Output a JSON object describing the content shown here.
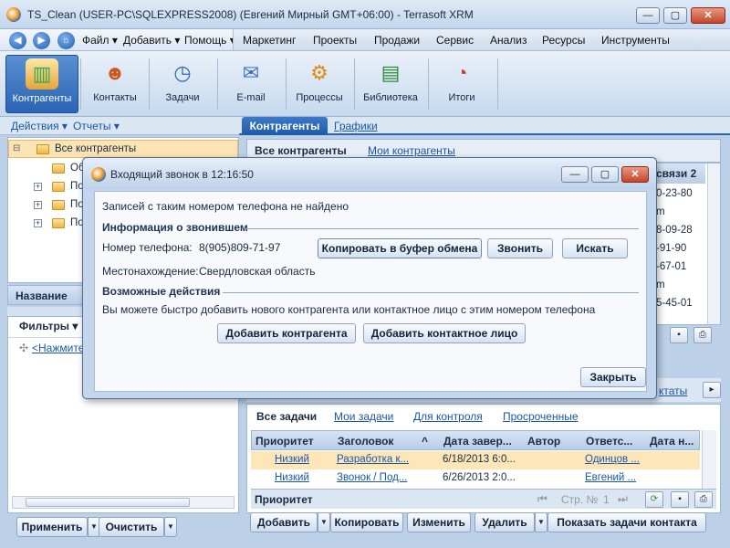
{
  "window": {
    "title": "TS_Clean (USER-PC\\SQLEXPRESS2008) (Евгений Мирный GMT+06:00) - Terrasoft XRM",
    "minimize": "—",
    "maximize": "▢",
    "close": "✕"
  },
  "menu": {
    "back": "◀",
    "forward": "▶",
    "home": "⌂",
    "items": [
      "Файл",
      "Добавить",
      "Помощь"
    ],
    "sections": [
      "Маркетинг",
      "Проекты",
      "Продажи",
      "Сервис",
      "Анализ",
      "Ресурсы",
      "Инструменты"
    ]
  },
  "ribbon": {
    "items": [
      {
        "label": "Контрагенты",
        "icon": "building-icon"
      },
      {
        "label": "Контакты",
        "icon": "contacts-icon"
      },
      {
        "label": "Задачи",
        "icon": "tasks-icon"
      },
      {
        "label": "E-mail",
        "icon": "email-icon"
      },
      {
        "label": "Процессы",
        "icon": "processes-icon"
      },
      {
        "label": "Библиотека",
        "icon": "library-icon"
      },
      {
        "label": "Итоги",
        "icon": "dashboard-icon"
      }
    ]
  },
  "subnav": {
    "actions": "Действия",
    "reports": "Отчеты",
    "tab_active": "Контрагенты",
    "tab_charts": "Графики"
  },
  "tree": {
    "root": "Все контрагенты",
    "child1": "Об",
    "child2": "По",
    "child3": "По",
    "child4": "По"
  },
  "left": {
    "name_header": "Название",
    "filters": "Фильтры",
    "filter_link": "<Нажмите",
    "apply": "Применить",
    "clear": "Очистить"
  },
  "right_grid": {
    "tab_all": "Все контрагенты",
    "tab_my": "Мои контрагенты",
    "col_header": "связи 2",
    "values": [
      "0-23-80",
      "m",
      "8-09-28",
      "-91-90",
      "-67-01",
      "m",
      "5-45-01"
    ]
  },
  "dialog": {
    "title": "Входящий звонок в 12:16:50",
    "not_found": "Записей с таким номером телефона не найдено",
    "info_header": "Информация о звонившем",
    "phone_label": "Номер телефона:",
    "phone_value": "8(905)809-71-97",
    "location_label": "Местонахождение:",
    "location_value": "Свердловская область",
    "copy_btn": "Копировать в буфер обмена",
    "call_btn": "Звонить",
    "search_btn": "Искать",
    "actions_header": "Возможные действия",
    "actions_text": "Вы можете быстро добавить нового контрагента или контактное лицо с этим номером телефона",
    "add_account": "Добавить контрагента",
    "add_contact": "Добавить контактное лицо",
    "close_btn": "Закрыть"
  },
  "tasks": {
    "partial_tab": "ктаты",
    "tabs": [
      "Все задачи",
      "Мои задачи",
      "Для контроля",
      "Просроченные"
    ],
    "columns": [
      "Приоритет",
      "Заголовок",
      "^",
      "Дата завер...",
      "Автор",
      "Ответс...",
      "Дата н..."
    ],
    "rows": [
      {
        "priority": "Низкий",
        "title": "Разработка к...",
        "date": "6/18/2013 6:0...",
        "author": "",
        "owner": "Одинцов ..."
      },
      {
        "priority": "Низкий",
        "title": "Звонок / Под...",
        "date": "6/26/2013 2:0...",
        "author": "",
        "owner": "Евгений ..."
      }
    ],
    "footer_label": "Приоритет",
    "page_label": "Стр. №",
    "page_num": "1",
    "buttons": [
      "Добавить",
      "Копировать",
      "Изменить",
      "Удалить",
      "Показать задачи контакта"
    ]
  }
}
